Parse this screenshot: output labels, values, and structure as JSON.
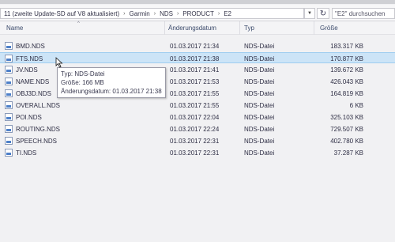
{
  "address_bar": {
    "breadcrumbs": [
      "11 (zweite Update-SD auf V8 aktualisiert)",
      "Garmin",
      "NDS",
      "PRODUCT",
      "E2"
    ],
    "dropdown_icon": "chevron-down-icon",
    "refresh_icon": "refresh-icon",
    "search_placeholder": "\"E2\" durchsuchen"
  },
  "columns": {
    "name": "Name",
    "date": "Änderungsdatum",
    "type": "Typ",
    "size": "Größe"
  },
  "files": [
    {
      "name": "BMD.NDS",
      "date": "01.03.2017 21:34",
      "type": "NDS-Datei",
      "size": "183.317 KB"
    },
    {
      "name": "FTS.NDS",
      "date": "01.03.2017 21:38",
      "type": "NDS-Datei",
      "size": "170.877 KB"
    },
    {
      "name": "JV.NDS",
      "date": "01.03.2017 21:41",
      "type": "NDS-Datei",
      "size": "139.672 KB"
    },
    {
      "name": "NAME.NDS",
      "date": "01.03.2017 21:53",
      "type": "NDS-Datei",
      "size": "426.043 KB"
    },
    {
      "name": "OBJ3D.NDS",
      "date": "01.03.2017 21:55",
      "type": "NDS-Datei",
      "size": "164.819 KB"
    },
    {
      "name": "OVERALL.NDS",
      "date": "01.03.2017 21:55",
      "type": "NDS-Datei",
      "size": "6 KB"
    },
    {
      "name": "POI.NDS",
      "date": "01.03.2017 22:04",
      "type": "NDS-Datei",
      "size": "325.103 KB"
    },
    {
      "name": "ROUTING.NDS",
      "date": "01.03.2017 22:24",
      "type": "NDS-Datei",
      "size": "729.507 KB"
    },
    {
      "name": "SPEECH.NDS",
      "date": "01.03.2017 22:31",
      "type": "NDS-Datei",
      "size": "402.780 KB"
    },
    {
      "name": "TI.NDS",
      "date": "01.03.2017 22:31",
      "type": "NDS-Datei",
      "size": "37.287 KB"
    }
  ],
  "selected_file": "FTS.NDS",
  "tooltip": {
    "line1": "Typ: NDS-Datei",
    "line2": "Größe: 166 MB",
    "line3": "Änderungsdatum: 01.03.2017 21:38"
  },
  "colors": {
    "selection": "#cce4f7",
    "file_icon_accent": "#4c7fc9"
  }
}
